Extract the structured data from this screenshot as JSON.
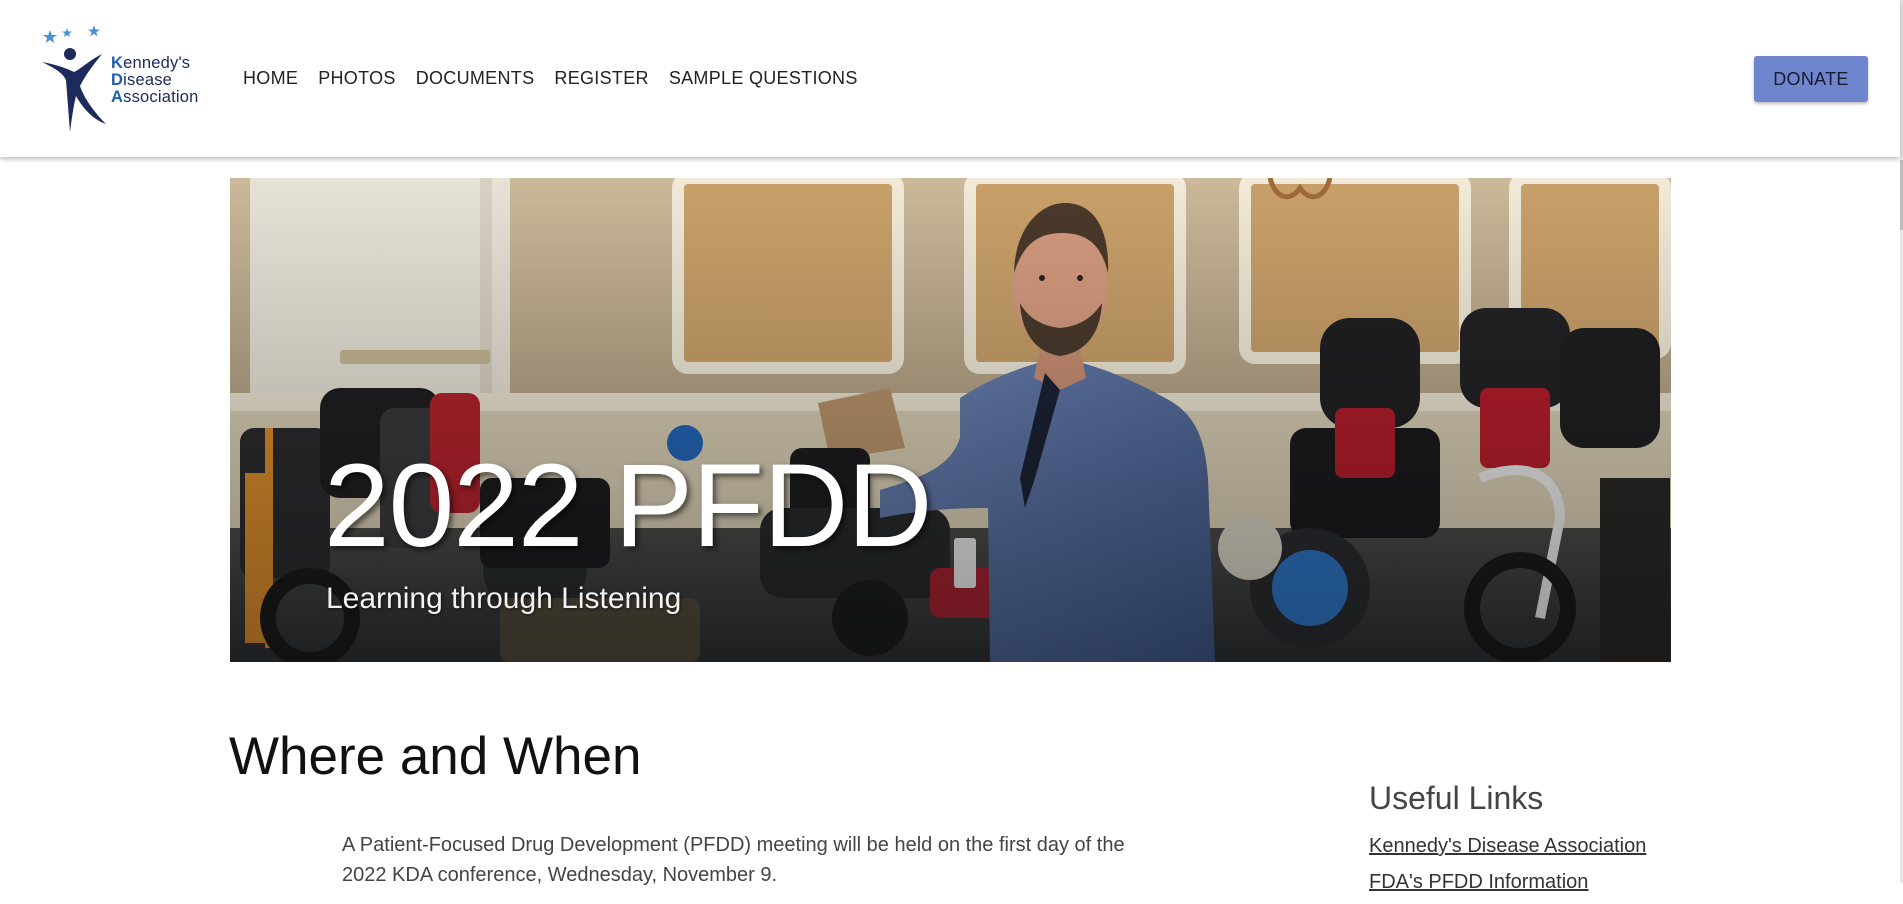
{
  "header": {
    "logo": {
      "line1_initial": "K",
      "line1_rest": "ennedy's",
      "line2_initial": "D",
      "line2_rest": "isease",
      "line3_initial": "A",
      "line3_rest": "ssociation"
    },
    "nav": [
      {
        "label": "HOME"
      },
      {
        "label": "PHOTOS"
      },
      {
        "label": "DOCUMENTS"
      },
      {
        "label": "REGISTER"
      },
      {
        "label": "SAMPLE QUESTIONS"
      }
    ],
    "donate_label": "DONATE"
  },
  "hero": {
    "title": "2022 PFDD",
    "subtitle": "Learning through Listening"
  },
  "main": {
    "section_title": "Where and When",
    "paragraph": "A Patient-Focused Drug Development (PFDD) meeting will be held on the first day of the 2022 KDA conference, Wednesday, November 9."
  },
  "sidebar": {
    "title": "Useful Links",
    "links": [
      {
        "label": "Kennedy's Disease Association"
      },
      {
        "label": "FDA's PFDD Information"
      }
    ]
  },
  "colors": {
    "donate_bg": "#6f86cf",
    "logo_navy": "#1c2a5c",
    "logo_blue": "#1f5fb0",
    "star_blue": "#4a90d9"
  },
  "icons": {
    "logo": "kda-figure-logo"
  }
}
